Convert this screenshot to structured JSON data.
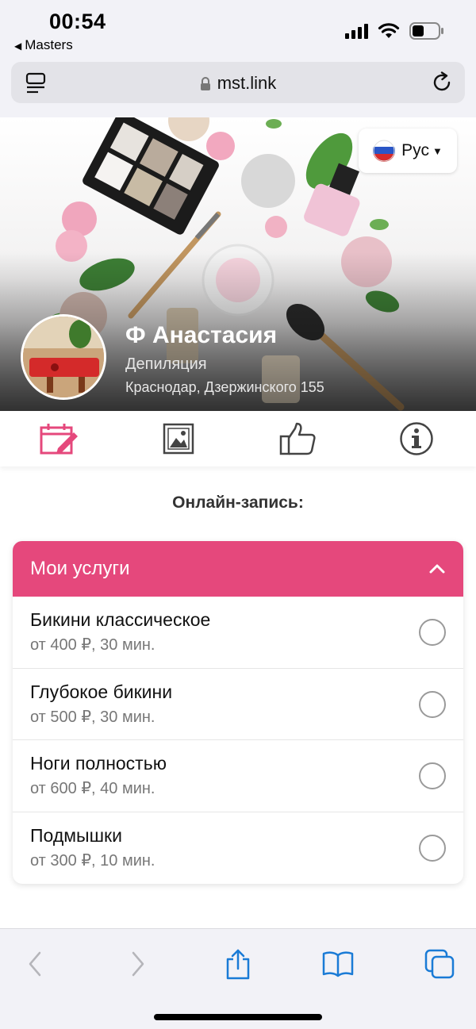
{
  "status_bar": {
    "time": "00:54",
    "back_label": "Masters"
  },
  "browser": {
    "url": "mst.link"
  },
  "hero": {
    "language_label": "Рус",
    "master_name": "Ф Анастасия",
    "specialty": "Депиляция",
    "address": "Краснодар, Дзержинского 155"
  },
  "tabs": [
    {
      "name": "calendar-icon",
      "active": true
    },
    {
      "name": "gallery-icon",
      "active": false
    },
    {
      "name": "thumbs-up-icon",
      "active": false
    },
    {
      "name": "info-icon",
      "active": false
    }
  ],
  "section_title": "Онлайн-запись:",
  "services": {
    "title": "Мои услуги",
    "items": [
      {
        "name": "Бикини классическое",
        "meta": "от 400 ₽, 30 мин."
      },
      {
        "name": "Глубокое бикини",
        "meta": "от 500 ₽, 30 мин."
      },
      {
        "name": "Ноги полностью",
        "meta": "от 600 ₽, 40 мин."
      },
      {
        "name": "Подмышки",
        "meta": "от 300 ₽, 10 мин."
      }
    ]
  },
  "colors": {
    "accent": "#e5487c",
    "ios_blue": "#1a7bd6"
  }
}
